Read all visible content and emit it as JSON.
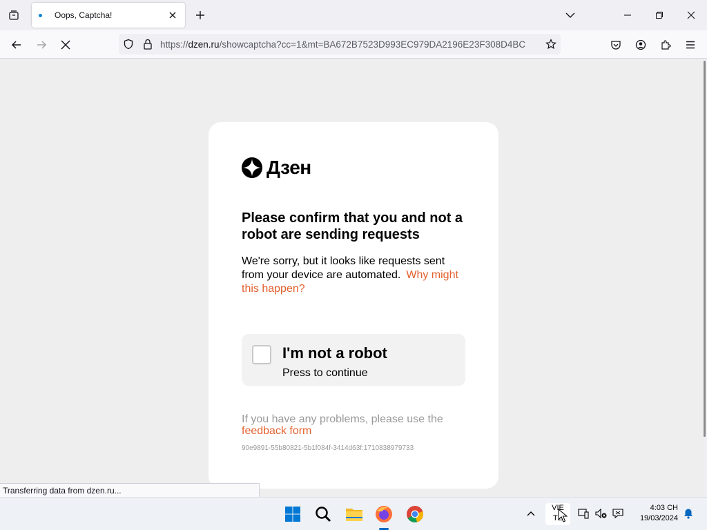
{
  "browser": {
    "tab": {
      "title": "Oops, Captcha!"
    },
    "url": {
      "scheme": "https://",
      "host": "dzen.ru",
      "path": "/showcaptcha?cc=1&mt=BA672B7523D993EC979DA2196E23F308D4BC"
    },
    "status_text": "Transferring data from dzen.ru..."
  },
  "captcha": {
    "logo_text": "Дзен",
    "heading": "Please confirm that you and not a robot are sending requests",
    "description": "We're sorry, but it looks like requests sent from your device are automated.",
    "why_link": "Why might this happen?",
    "checkbox_title": "I'm not a robot",
    "checkbox_subtitle": "Press to continue",
    "problems_text": "If you have any problems, please use the",
    "feedback_link": "feedback form",
    "token": "90e9891-55b80821-5b1f084f-3414d63f:1710838979733"
  },
  "taskbar": {
    "lang_line1": "VIE",
    "lang_line2": "TE",
    "time": "4:03 CH",
    "date": "19/03/2024"
  },
  "colors": {
    "link": "#e35f2b",
    "accent": "#0067c0"
  }
}
